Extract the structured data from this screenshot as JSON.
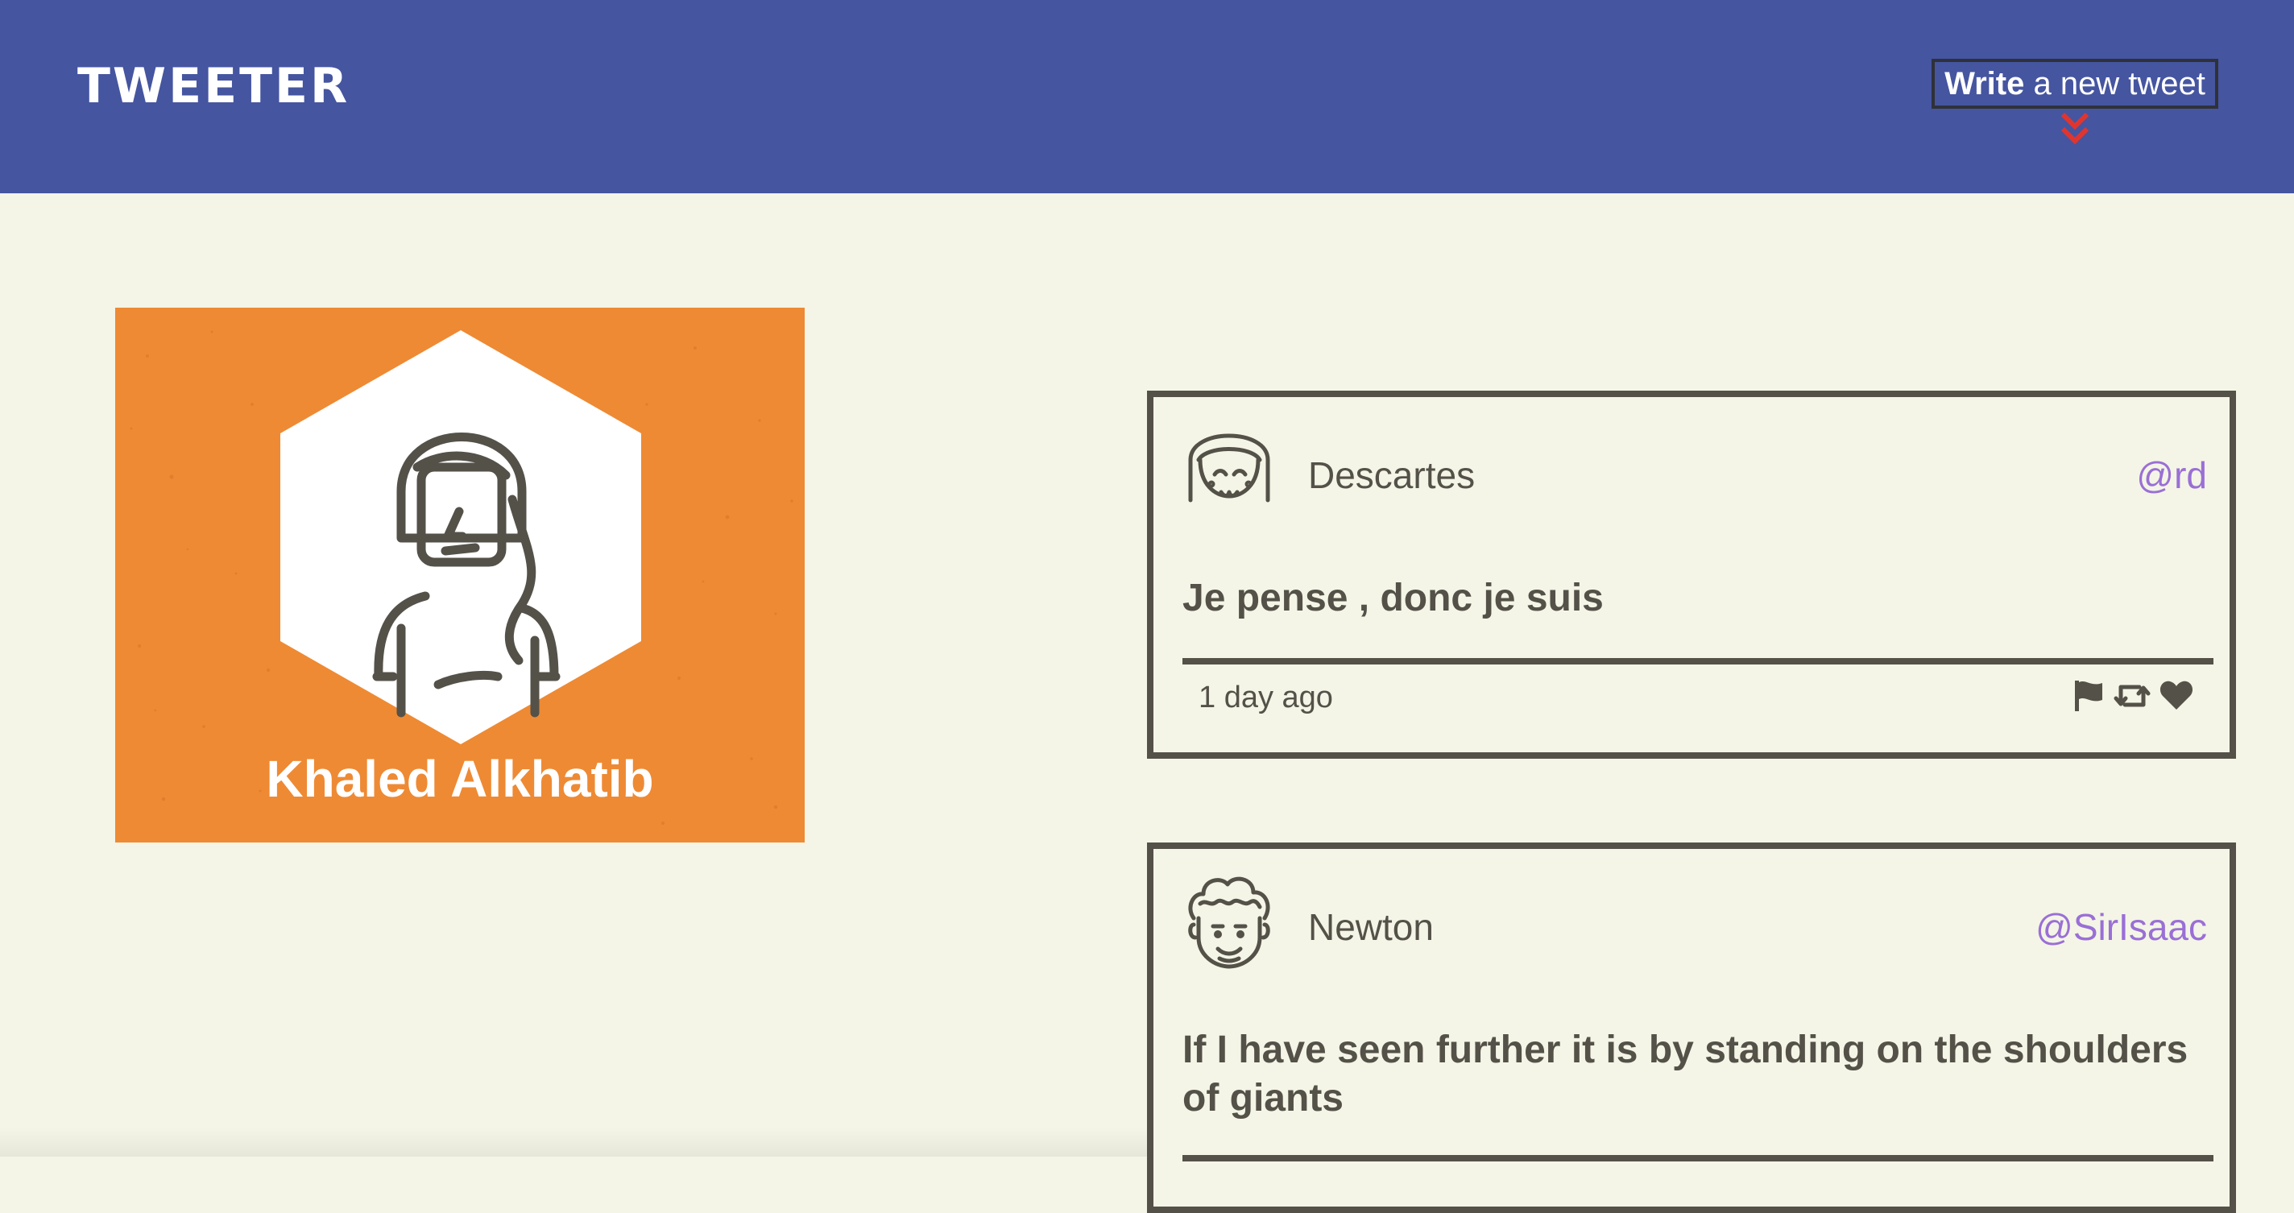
{
  "app": {
    "brand": "TWEETER"
  },
  "nav": {
    "compose_bold": "Write",
    "compose_rest": " a new tweet",
    "compose_icon": "double-chevron-down-icon"
  },
  "colors": {
    "nav_bg": "#4555a0",
    "page_bg": "#f4f5e6",
    "profile_bg": "#ee8a34",
    "border": "#545149",
    "handle": "#9a6fd6",
    "chevron": "#e0352f"
  },
  "profile": {
    "name": "Khaled Alkhatib",
    "avatar_icon": "woman-avatar-icon"
  },
  "tweets": [
    {
      "author": "Descartes",
      "handle": "@rd",
      "text": "Je pense , donc je suis",
      "time": "1 day ago",
      "avatar_icon": "bob-hair-avatar-icon",
      "actions": [
        "flag-icon",
        "retweet-icon",
        "heart-icon"
      ]
    },
    {
      "author": "Newton",
      "handle": "@SirIsaac",
      "text": "If I have seen further it is by standing on the shoulders of giants",
      "avatar_icon": "curly-hair-avatar-icon"
    }
  ]
}
